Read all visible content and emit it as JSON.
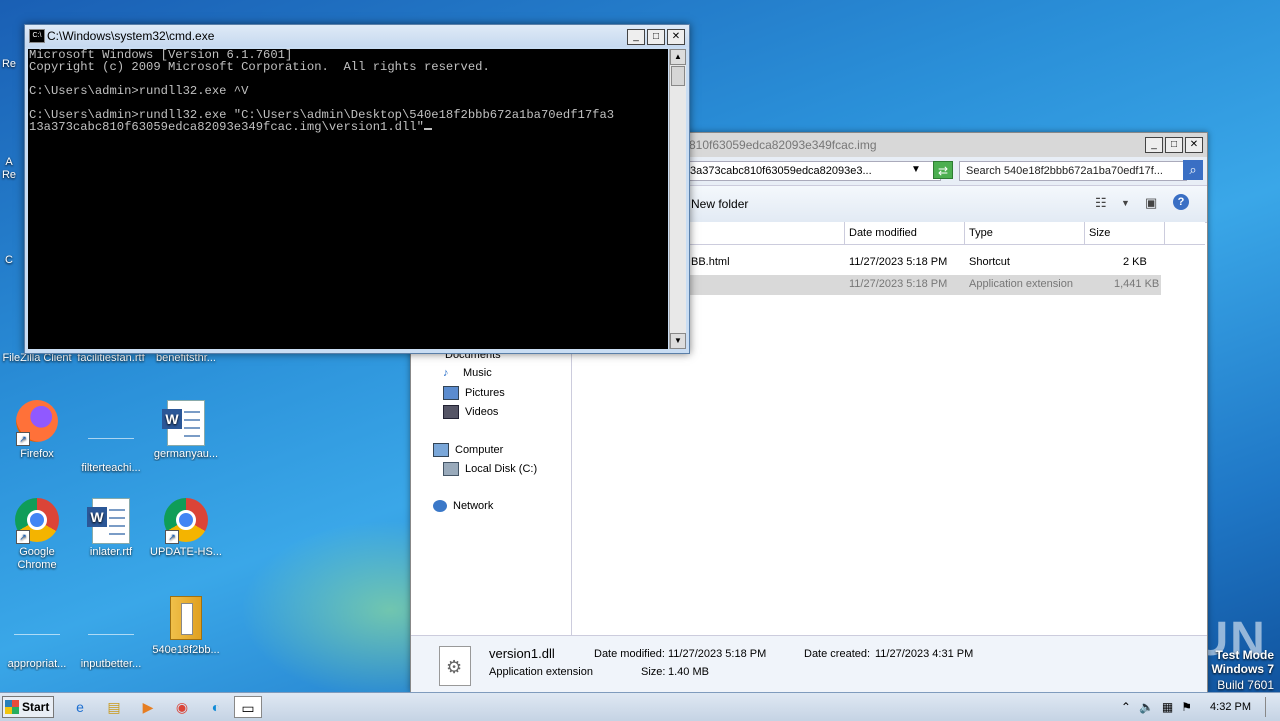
{
  "desktop": {
    "row1": [
      {
        "label": "FileZilla Client"
      },
      {
        "label": "facilitiesfan.rtf"
      },
      {
        "label": "benefitsthr..."
      }
    ],
    "row2": [
      {
        "label": "Firefox"
      },
      {
        "label": "filterteachi..."
      },
      {
        "label": "germanyau..."
      }
    ],
    "row3": [
      {
        "label": "Google Chrome"
      },
      {
        "label": "inlater.rtf"
      },
      {
        "label": "UPDATE-HS..."
      }
    ],
    "row4": [
      {
        "label": "appropriat..."
      },
      {
        "label": "inputbetter..."
      },
      {
        "label": "540e18f2bb..."
      }
    ],
    "left_partial_labels": [
      "Re",
      "A",
      "Re",
      "C"
    ],
    "watermark": "ANY RUN",
    "os_label": {
      "line1": "Test Mode",
      "line2": "Windows 7",
      "line3": "Build 7601"
    }
  },
  "cmd": {
    "title": "C:\\Windows\\system32\\cmd.exe",
    "lines": [
      "Microsoft Windows [Version 6.1.7601]",
      "Copyright (c) 2009 Microsoft Corporation.  All rights reserved.",
      "",
      "C:\\Users\\admin>rundll32.exe ^V",
      "",
      "C:\\Users\\admin>rundll32.exe \"C:\\Users\\admin\\Desktop\\540e18f2bbb672a1ba70edf17fa3",
      "13a373cabc810f63059edca82093e349fcac.img\\version1.dll\""
    ]
  },
  "explorer": {
    "title": "810f63059edca82093e349fcac.img",
    "address": "3a373cabc810f63059edca82093e3...",
    "search_placeholder": "Search 540e18f2bbb672a1ba70edf17f...",
    "new_folder": "New folder",
    "columns": [
      "Date modified",
      "Type",
      "Size"
    ],
    "rows": [
      {
        "name": "BB.html",
        "date": "11/27/2023 5:18 PM",
        "type": "Shortcut",
        "size": "2 KB"
      },
      {
        "name": "",
        "date": "11/27/2023 5:18 PM",
        "type": "Application extension",
        "size": "1,441 KB"
      }
    ],
    "nav": {
      "documents": "Documents",
      "music": "Music",
      "pictures": "Pictures",
      "videos": "Videos",
      "computer": "Computer",
      "local_disk": "Local Disk (C:)",
      "network": "Network"
    },
    "details": {
      "filename": "version1.dll",
      "filetype": "Application extension",
      "date_modified_label": "Date modified:",
      "date_modified": "11/27/2023 5:18 PM",
      "date_created_label": "Date created:",
      "date_created": "11/27/2023 4:31 PM",
      "size_label": "Size:",
      "size": "1.40 MB"
    }
  },
  "taskbar": {
    "start_label": "Start",
    "clock": "4:32 PM"
  }
}
